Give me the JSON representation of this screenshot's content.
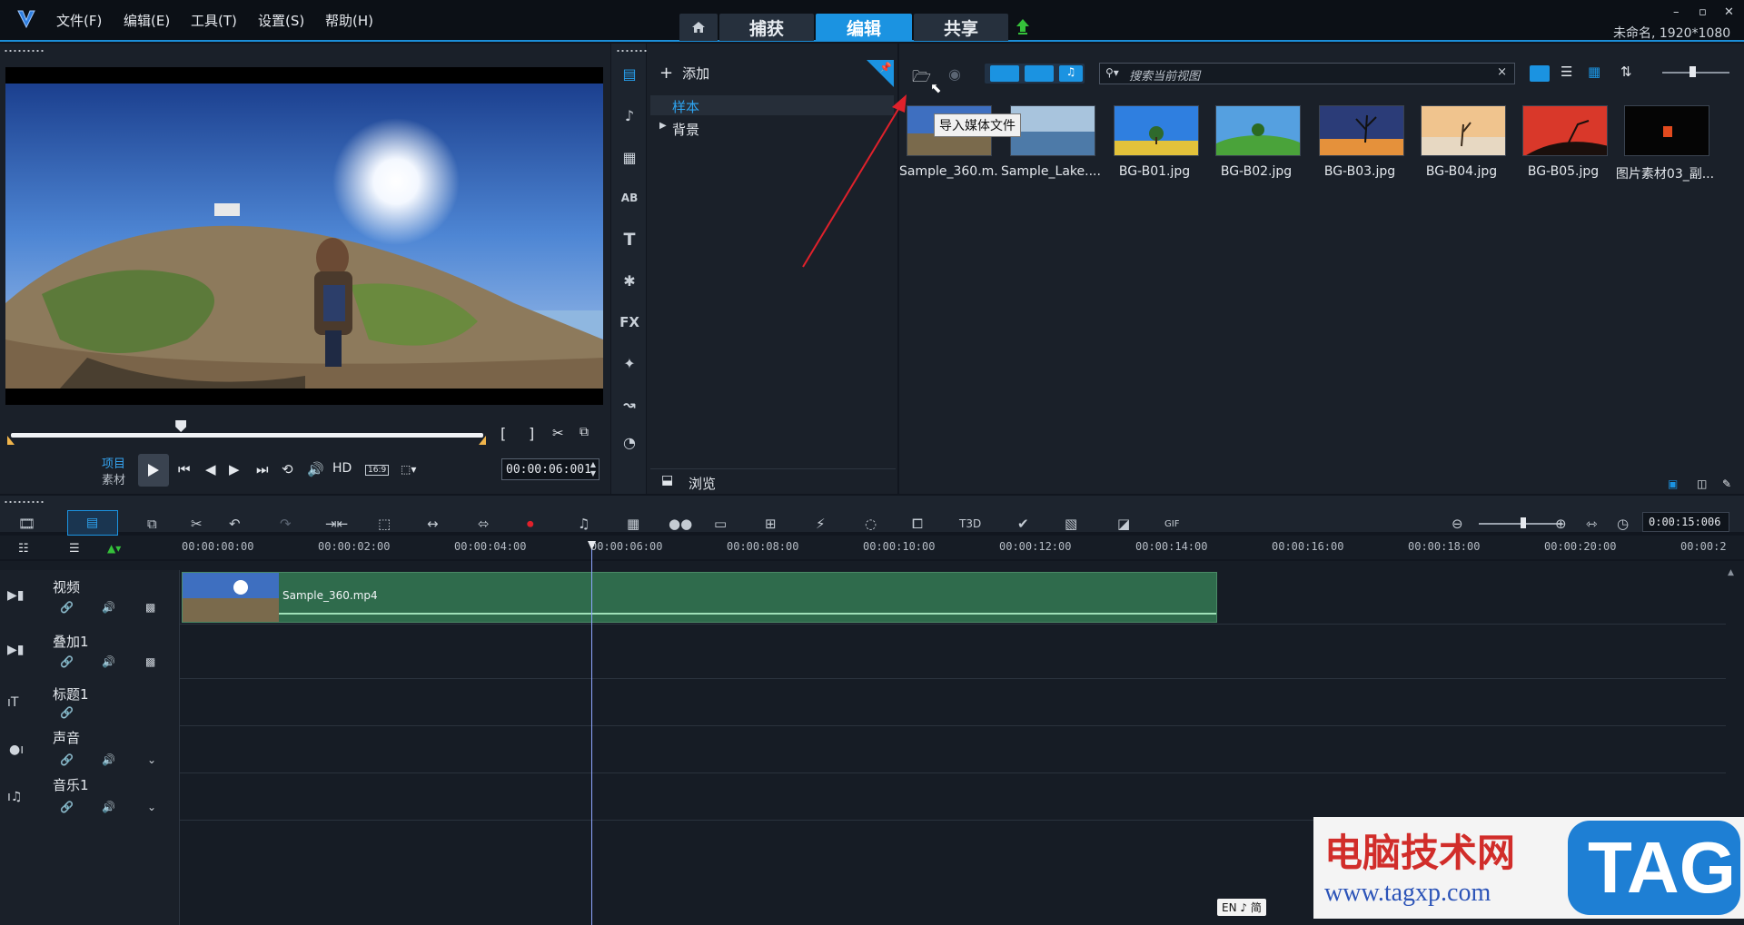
{
  "menu": [
    "文件(F)",
    "编辑(E)",
    "工具(T)",
    "设置(S)",
    "帮助(H)"
  ],
  "mode_tabs": {
    "capture": "捕获",
    "edit": "编辑",
    "share": "共享"
  },
  "window": {
    "title_info": "未命名, 1920*1080",
    "minimize": "–",
    "restore": "▫",
    "close": "✕"
  },
  "player": {
    "project_label": "项目",
    "clip_label": "素材",
    "hd_label": "HD",
    "aspect_label": "16:9",
    "timecode": "00:00:06:001",
    "progress": 0.36
  },
  "library": {
    "add_label": "添加",
    "tree": [
      "样本",
      "背景"
    ],
    "browse_label": "浏览",
    "search_placeholder": "搜索当前视图",
    "tooltip": "导入媒体文件",
    "items": [
      {
        "name": "Sample_360.m..."
      },
      {
        "name": "Sample_Lake...."
      },
      {
        "name": "BG-B01.jpg"
      },
      {
        "name": "BG-B02.jpg"
      },
      {
        "name": "BG-B03.jpg"
      },
      {
        "name": "BG-B04.jpg"
      },
      {
        "name": "BG-B05.jpg"
      },
      {
        "name": "图片素材03_副..."
      }
    ]
  },
  "timeline": {
    "duration": "0:00:15:006",
    "ruler": [
      "00:00:00:00",
      "00:00:02:00",
      "00:00:04:00",
      "00:00:06:00",
      "00:00:08:00",
      "00:00:10:00",
      "00:00:12:00",
      "00:00:14:00",
      "00:00:16:00",
      "00:00:18:00",
      "00:00:20:00",
      "00:00:2"
    ],
    "tracks": [
      "视频",
      "叠加1",
      "标题1",
      "声音",
      "音乐1"
    ],
    "clip_name": "Sample_360.mp4",
    "playhead_time": "00:00:06:00"
  },
  "ime": "EN ♪ 简",
  "watermark": {
    "title": "电脑技术网",
    "url": "www.tagxp.com",
    "tag": "TAG"
  },
  "colors": {
    "accent": "#1b93e1",
    "clip": "#2f6b4c",
    "arrow": "#e0212b"
  }
}
